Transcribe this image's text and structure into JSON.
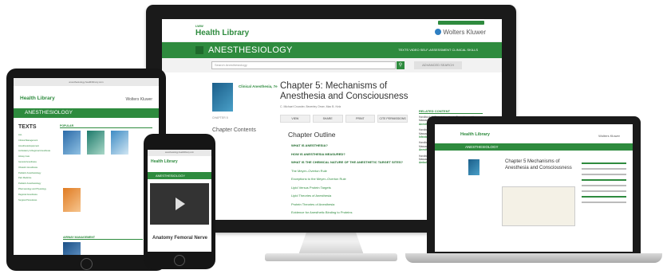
{
  "desktop": {
    "brand_small": "LWW",
    "brand": "Health Library",
    "publisher": "Wolters Kluwer",
    "section": "ANESTHESIOLOGY",
    "nav": "TEXTS   VIDEO   SELF-ASSESSMENT   CLINICAL SKILLS",
    "search_placeholder": "Search Anesthesiology",
    "advanced_search": "ADVANCED SEARCH",
    "book_title": "Clinical Anesthesia, 7e",
    "chapter_label": "CHAPTER 5",
    "chapter_contents": "Chapter Contents",
    "chapter_title": "Chapter 5: Mechanisms of Anesthesia and Consciousness",
    "authors": "C. Michael Crowder, Beverley Orser, Max B. Kelz",
    "toolbar": [
      "VIEW",
      "SHARE",
      "PRINT",
      "CITE PERMISSIONS"
    ],
    "outline_title": "Chapter Outline",
    "outline": [
      {
        "text": "WHAT IS ANESTHESIA?",
        "bold": true
      },
      {
        "text": "HOW IS ANESTHESIA MEASURED?",
        "bold": true
      },
      {
        "text": "WHAT IS THE CHEMICAL NATURE OF THE ANESTHETIC TARGET SITES?",
        "bold": true
      },
      {
        "text": "The Meyer–Overton Rule",
        "bold": false
      },
      {
        "text": "Exceptions to the Meyer–Overton Rule",
        "bold": false
      },
      {
        "text": "Lipid Versus Protein Targets",
        "bold": false
      },
      {
        "text": "Lipid Theories of Anesthesia",
        "bold": false
      },
      {
        "text": "Protein Theories of Anesthesia",
        "bold": false
      },
      {
        "text": "Evidence for Anesthetic Binding to Proteins",
        "bold": false
      }
    ],
    "related_heading": "RELATED CONTENT",
    "related": [
      {
        "text": "Handbook of Clinical Anesthesia Procedures of the Massachusetts General Hospital, 8e",
        "link": "Anesthesia for Oral Surgery"
      },
      {
        "text": "Handbook of Clinical Anesthesia Procedures of the Massachusetts General Hospital, 8e",
        "link": "Infectious Diseases and Infection Control"
      },
      {
        "text": "Handbook of Clinical Anesthesia Procedures of the Massachusetts General Hospital, 8e",
        "link": "Anesthesia for Surgical Emergencies in the Neonate"
      },
      {
        "text": "Handbook of Clinical Anesthesia Procedures of the Massachusetts General Hospital, 8e",
        "link": "Ambulatory Anesthesia"
      }
    ]
  },
  "tablet": {
    "address": "anesthesiology.healthlibrary.com",
    "brand": "Health Library",
    "publisher": "Wolters Kluwer",
    "section": "ANESTHESIOLOGY",
    "texts_heading": "TEXTS",
    "texts": [
      "ALL",
      "Clinical Management",
      "Anesthesia Equipment",
      "Ambulatory & Regional Anesthesia",
      "Airway Care",
      "General Anesthesia",
      "Obstetric Anesthesia",
      "Pediatric Anesthesiology",
      "Pain Medicine",
      "Pediatric Anesthesiology",
      "Pharmacology and Physiology",
      "Regional Anesthesia",
      "Surgical Procedures"
    ],
    "popular": "POPULAR",
    "airway": "AIRWAY MANAGEMENT"
  },
  "phone": {
    "address": "anesthesiology.healthlibrary.com",
    "brand": "Health Library",
    "section": "ANESTHESIOLOGY",
    "caption": "Anatomy Femoral Nerve"
  },
  "laptop": {
    "brand": "Health Library",
    "publisher": "Wolters Kluwer",
    "section": "ANESTHESIOLOGY",
    "chapter_title": "Chapter 5 Mechanisms of Anesthesia and Consciousness"
  }
}
